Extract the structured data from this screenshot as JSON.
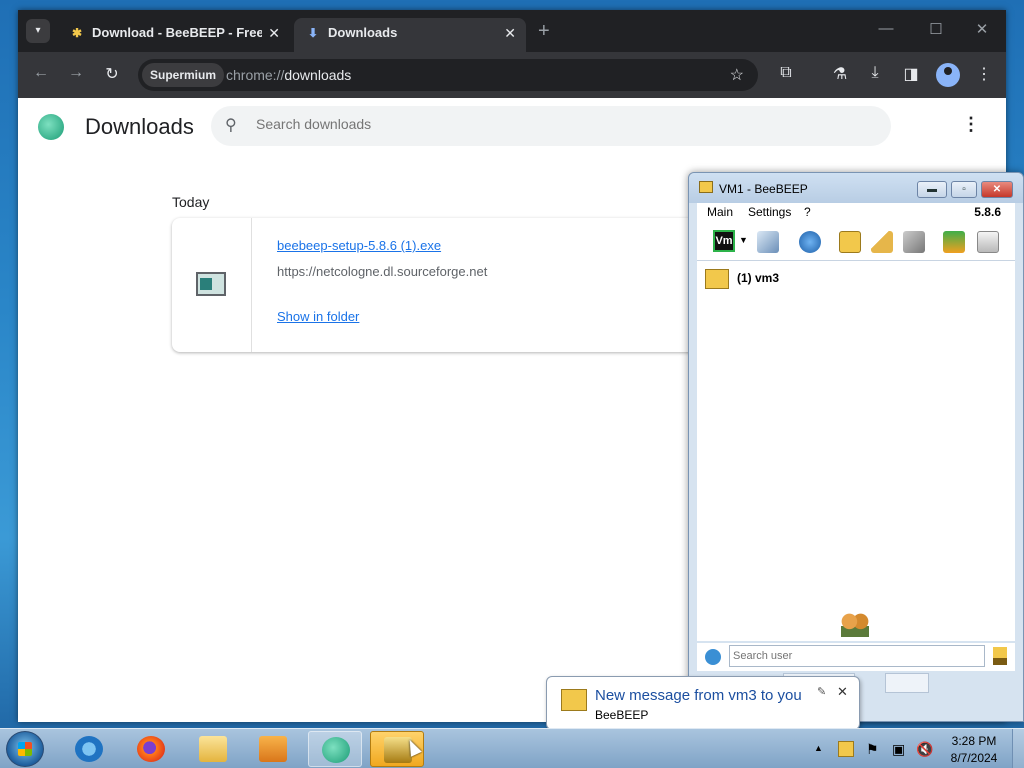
{
  "browser": {
    "tabs": [
      {
        "title": "Download - BeeBEEP - Free Of",
        "icon": "bee-icon"
      },
      {
        "title": "Downloads",
        "icon": "download-icon"
      }
    ],
    "site_chip": "Supermium",
    "url_scheme": "chrome://",
    "url_host": "downloads"
  },
  "downloads_page": {
    "title": "Downloads",
    "search_placeholder": "Search downloads",
    "section_label": "Today",
    "item": {
      "filename": "beebeep-setup-5.8.6 (1).exe",
      "source": "https://netcologne.dl.sourceforge.net",
      "action": "Show in folder"
    }
  },
  "beebeep": {
    "title": "VM1 - BeeBEEP",
    "menu": [
      "Main",
      "Settings",
      "?"
    ],
    "version": "5.8.6",
    "vm_badge": "Vm",
    "user": "(1) vm3",
    "search_placeholder": "Search user"
  },
  "notification": {
    "title": "New message from vm3 to you",
    "app": "BeeBEEP"
  },
  "taskbar": {
    "time": "3:28 PM",
    "date": "8/7/2024"
  },
  "colors": {
    "chrome_dark": "#202124",
    "link_blue": "#1a73e8",
    "bee_yellow": "#f2c84b",
    "taskbar": "#a9c4de"
  }
}
